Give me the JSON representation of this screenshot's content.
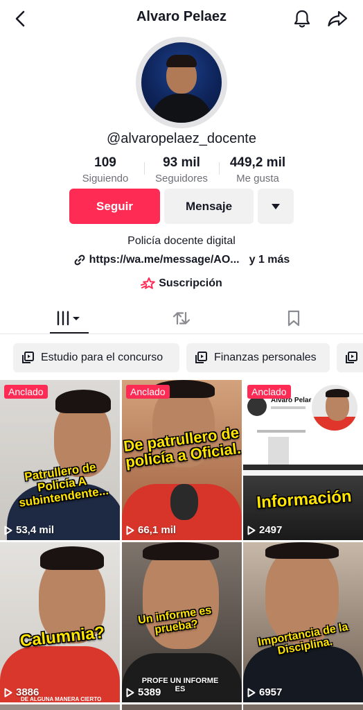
{
  "header": {
    "title": "Alvaro Pelaez",
    "back_icon": "chevron-left-icon",
    "bell_icon": "bell-icon",
    "share_icon": "share-icon"
  },
  "profile": {
    "username": "@alvaropelaez_docente",
    "stats": [
      {
        "value": "109",
        "label": "Siguiendo"
      },
      {
        "value": "93 mil",
        "label": "Seguidores"
      },
      {
        "value": "449,2 mil",
        "label": "Me gusta"
      }
    ],
    "buttons": {
      "follow": "Seguir",
      "message": "Mensaje"
    },
    "bio": "Policía docente digital",
    "link": "https://wa.me/message/AO...",
    "link_more": "y 1 más",
    "subscription": "Suscripción"
  },
  "playlists": [
    "Estudio para el concurso",
    "Finanzas personales"
  ],
  "videos": [
    {
      "pinned": "Anclado",
      "caption": "Patrullero de Policía A subintendente...",
      "views": "53,4 mil"
    },
    {
      "pinned": "Anclado",
      "caption": "De patrullero de policía a Oficial.",
      "views": "66,1 mil"
    },
    {
      "pinned": "Anclado",
      "caption": "Información",
      "views": "2497",
      "screen_title": "Alvaro Pelaez"
    },
    {
      "pinned": "",
      "caption": "Calumnia?",
      "views": "3886",
      "bottom_text": "DE ALGUNA MANERA CIERTO"
    },
    {
      "pinned": "",
      "caption": "Un informe es prueba?",
      "views": "5389",
      "sub_caption": "PROFE UN INFORME ES"
    },
    {
      "pinned": "",
      "caption": "Importancia de la Disciplina.",
      "views": "6957"
    }
  ],
  "colors": {
    "accent": "#fe2c55",
    "pill_bg": "#f1f1f2",
    "caption_yellow": "#ffe500"
  }
}
